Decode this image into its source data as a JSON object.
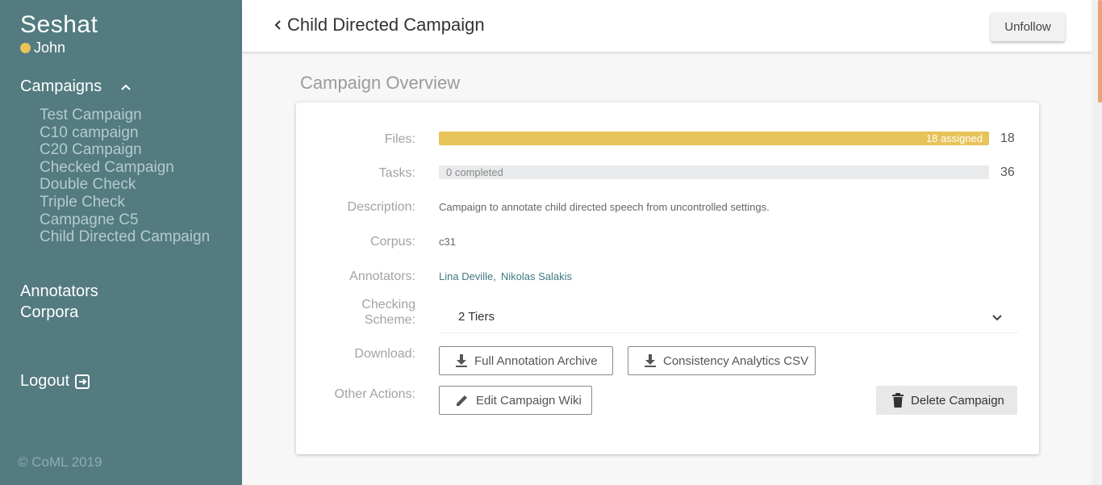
{
  "sidebar": {
    "brand": "Seshat",
    "user": "John",
    "campaigns_label": "Campaigns",
    "campaigns": [
      "Test Campaign",
      "C10 campaign",
      "C20 Campaign",
      "Checked Campaign",
      "Double Check",
      "Triple Check",
      "Campagne C5",
      "Child Directed Campaign"
    ],
    "annotators_label": "Annotators",
    "corpora_label": "Corpora",
    "logout_label": "Logout",
    "copyright": "© CoML 2019"
  },
  "header": {
    "title": "Child Directed Campaign",
    "unfollow_label": "Unfollow"
  },
  "main": {
    "section_title": "Campaign Overview",
    "files": {
      "label": "Files:",
      "bar_text": "18 assigned",
      "count": "18",
      "progress": 1.0
    },
    "tasks": {
      "label": "Tasks:",
      "bar_text": "0 completed",
      "count": "36",
      "progress": 0.0
    },
    "description": {
      "label": "Description:",
      "value": "Campaign to annotate child directed speech from uncontrolled settings."
    },
    "corpus": {
      "label": "Corpus:",
      "value": "c31"
    },
    "annotators": {
      "label": "Annotators:",
      "names": [
        "Lina Deville,",
        "Nikolas Salakis"
      ]
    },
    "checking": {
      "label_line1": "Checking",
      "label_line2": "Scheme:",
      "selected": "2 Tiers"
    },
    "download": {
      "label": "Download:",
      "archive_label": "Full Annotation Archive",
      "csv_label": "Consistency Analytics CSV"
    },
    "other": {
      "label": "Other Actions:",
      "wiki_label": "Edit Campaign Wiki",
      "delete_label": "Delete Campaign"
    }
  },
  "colors": {
    "sidebar_bg": "#537b80",
    "accent_yellow": "#e8c35a",
    "link": "#3f7a82"
  }
}
